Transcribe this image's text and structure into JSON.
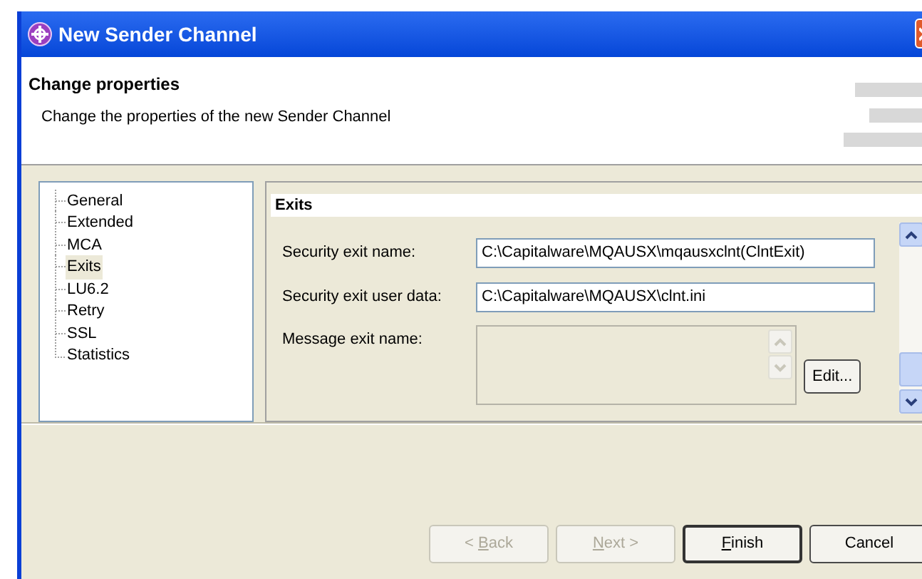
{
  "window": {
    "title": "New Sender Channel"
  },
  "header": {
    "title": "Change properties",
    "description": "Change the properties of the new Sender Channel"
  },
  "tree": {
    "items": [
      {
        "label": "General",
        "selected": false
      },
      {
        "label": "Extended",
        "selected": false
      },
      {
        "label": "MCA",
        "selected": false
      },
      {
        "label": "Exits",
        "selected": true
      },
      {
        "label": "LU6.2",
        "selected": false
      },
      {
        "label": "Retry",
        "selected": false
      },
      {
        "label": "SSL",
        "selected": false
      },
      {
        "label": "Statistics",
        "selected": false
      }
    ]
  },
  "page": {
    "title": "Exits",
    "fields": [
      {
        "kind": "text",
        "label": "Security exit name:",
        "value": "C:\\Capitalware\\MQAUSX\\mqausxclnt(ClntExit)"
      },
      {
        "kind": "text",
        "label": "Security exit user data:",
        "value": "C:\\Capitalware\\MQAUSX\\clnt.ini"
      },
      {
        "kind": "list",
        "label": "Message exit name:",
        "button": "Edit..."
      }
    ]
  },
  "buttons": [
    {
      "before": "< ",
      "mnemonic": "B",
      "after": "ack",
      "disabled": true,
      "default": false
    },
    {
      "mnemonic": "N",
      "after": "ext >",
      "disabled": true,
      "default": false
    },
    {
      "mnemonic": "F",
      "after": "inish",
      "disabled": false,
      "default": true
    },
    {
      "after": "Cancel",
      "disabled": false,
      "default": false
    }
  ]
}
